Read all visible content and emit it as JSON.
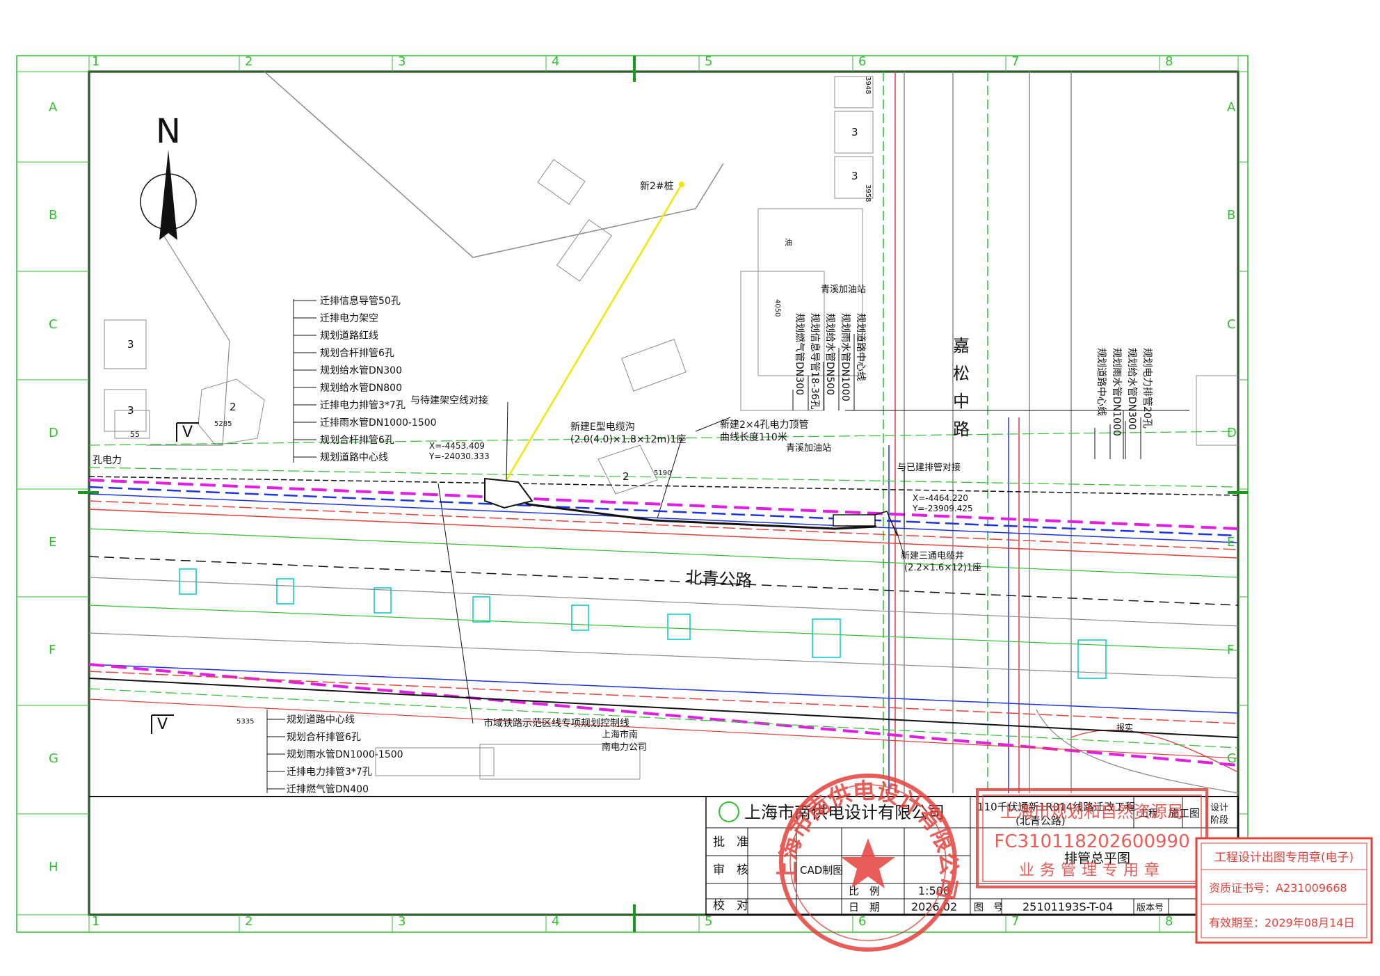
{
  "grid": {
    "columns": [
      "1",
      "2",
      "3",
      "4",
      "5",
      "6",
      "7",
      "8"
    ],
    "rows": [
      "A",
      "B",
      "C",
      "D",
      "E",
      "F",
      "G",
      "H"
    ]
  },
  "north": "N",
  "section_mark": "V",
  "map_labels": {
    "pile": "新2#桩",
    "gas_station_a": "青溪加油站",
    "gas_station_b": "青溪加油站",
    "road_main": "北青公路",
    "road_cross": "嘉松中路",
    "power_left": "孔电力",
    "power_bottom_a": "上海市南",
    "power_bottom_b": "南电力公司",
    "bottom_label": "报实",
    "bldg_3a": "3",
    "bldg_3b": "3",
    "bldg_3c": "3",
    "bldg_3d": "3",
    "bldg_2a": "2",
    "bldg_2b": "2",
    "bldg_55": "55",
    "bldg_5285": "5285",
    "bldg_4050": "4050",
    "bldg_3958": "3958",
    "bldg_3948": "3948",
    "bldg_5190": "5190",
    "bldg_5335": "5335",
    "oil": "油"
  },
  "coords": {
    "p1_x": "X=-4453.409",
    "p1_y": "Y=-24030.333",
    "p2_x": "X=-4464.220",
    "p2_y": "Y=-23909.425"
  },
  "callouts": {
    "connect_overhead": "与待建架空线对接",
    "new_trench": "新建E型电缆沟",
    "new_trench_size": "(2.0(4.0)×1.8×12m)1座",
    "new_pipe": "新建2×4孔电力顶管",
    "new_pipe_len": "曲线长度110米",
    "connect_existing": "与已建排管对接",
    "new_well": "新建三通电缆井",
    "new_well_size": "(2.2×1.6×12)1座",
    "rail_line": "市域铁路示范区线专项规划控制线"
  },
  "legend_top": [
    "迁排信息导管50孔",
    "迁排电力架空",
    "规划道路红线",
    "规划合杆排管6孔",
    "规划给水管DN300",
    "规划给水管DN800",
    "迁排电力排管3*7孔",
    "迁排雨水管DN1000-1500",
    "规划合杆排管6孔",
    "规划道路中心线"
  ],
  "legend_bottom": [
    "规划道路中心线",
    "规划合杆排管6孔",
    "规划雨水管DN1000-1500",
    "迁排电力排管3*7孔",
    "迁排燃气管DN400"
  ],
  "vertical_mid": [
    "规划燃气管DN300",
    "规划信息导管18-36孔",
    "规划给水管DN500",
    "规划雨水管DN1000",
    "规划道路中心线"
  ],
  "vertical_right": [
    "规划电力排管20孔",
    "规划给水管DN300",
    "规划雨水管DN1000",
    "规划道路中心线"
  ],
  "title_block": {
    "company": "上海市南供电设计有限公司",
    "project": "110千伏通新1R014线路迁改工程",
    "project_sub": "(北青公路)",
    "stage_label": "工程",
    "stage_value": "施工图",
    "design_label": "设计",
    "design_label2": "阶段",
    "approve": "批　准",
    "review": "审　核",
    "check": "校　对",
    "scale_label": "比　例",
    "scale_value": "1:500",
    "date_label": "日　期",
    "date_value": "2026.02",
    "drawing_title": "排管总平图",
    "drawing_no_label": "图　号",
    "drawing_no": "25101193S-T-04",
    "version_label": "版本号",
    "cad_label": "CAD制图"
  },
  "stamps": {
    "round_text": "上海市南供电设计有限公司",
    "rect_code": "FC310118202600990",
    "rect_top": "上海市规划和自然资源局",
    "rect_bottom": "业务管理专用章",
    "seal_title": "工程设计出图专用章(电子)",
    "seal_cert": "资质证书号：A231009668",
    "seal_valid": "有效期至：2029年08月14日"
  },
  "colors": {
    "grid": "#2fbf2f",
    "red": "#e4413a",
    "magenta": "#e020e0",
    "blue": "#1e34e0",
    "yellow": "#f0e800",
    "cyan": "#00c8c8"
  }
}
